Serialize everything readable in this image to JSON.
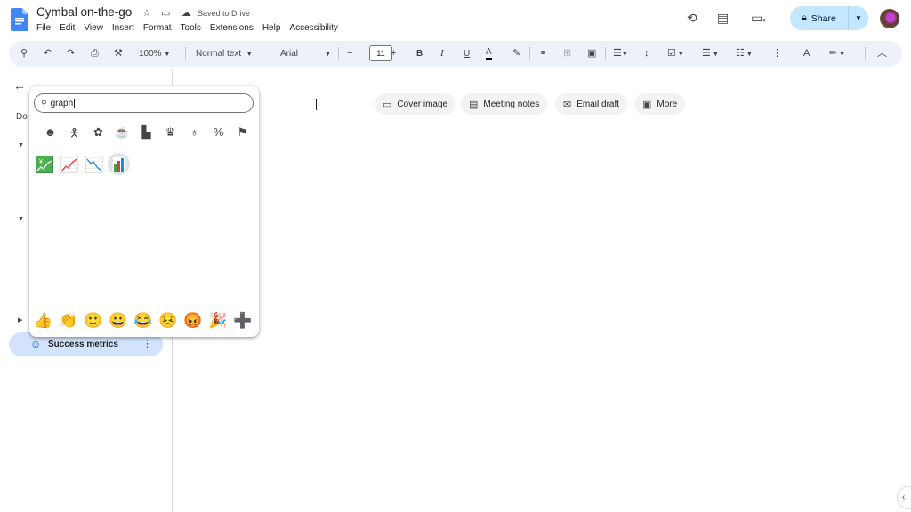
{
  "app": {
    "doc_title": "Cymbal on-the-go",
    "saved_status": "Saved to Drive",
    "menu": [
      "File",
      "Edit",
      "View",
      "Insert",
      "Format",
      "Tools",
      "Extensions",
      "Help",
      "Accessibility"
    ],
    "share_label": "Share",
    "brand_color": "#4285f4",
    "share_bg": "#c2e7ff"
  },
  "toolbar": {
    "zoom": "100%",
    "style": "Normal text",
    "font": "Arial",
    "font_size": "11",
    "bold": "B",
    "italic": "I",
    "underline": "U",
    "text_color": "A"
  },
  "sidebar": {
    "doc_label_partial": "Do",
    "active_item": "Success metrics"
  },
  "emoji_picker": {
    "search_value": "graph",
    "categories": [
      "smiley-icon",
      "person-icon",
      "animal-icon",
      "food-icon",
      "travel-icon",
      "trophy-icon",
      "bulb-icon",
      "symbols-icon",
      "flag-icon"
    ],
    "results": [
      "chart-increasing-with-yen",
      "chart-increasing",
      "chart-decreasing",
      "bar-chart"
    ],
    "quick_reactions": [
      "👍",
      "👏",
      "🙂",
      "😀",
      "😂",
      "😣",
      "😡",
      "🎉",
      "➕"
    ]
  },
  "chips": [
    "Cover image",
    "Meeting notes",
    "Email draft",
    "More"
  ]
}
